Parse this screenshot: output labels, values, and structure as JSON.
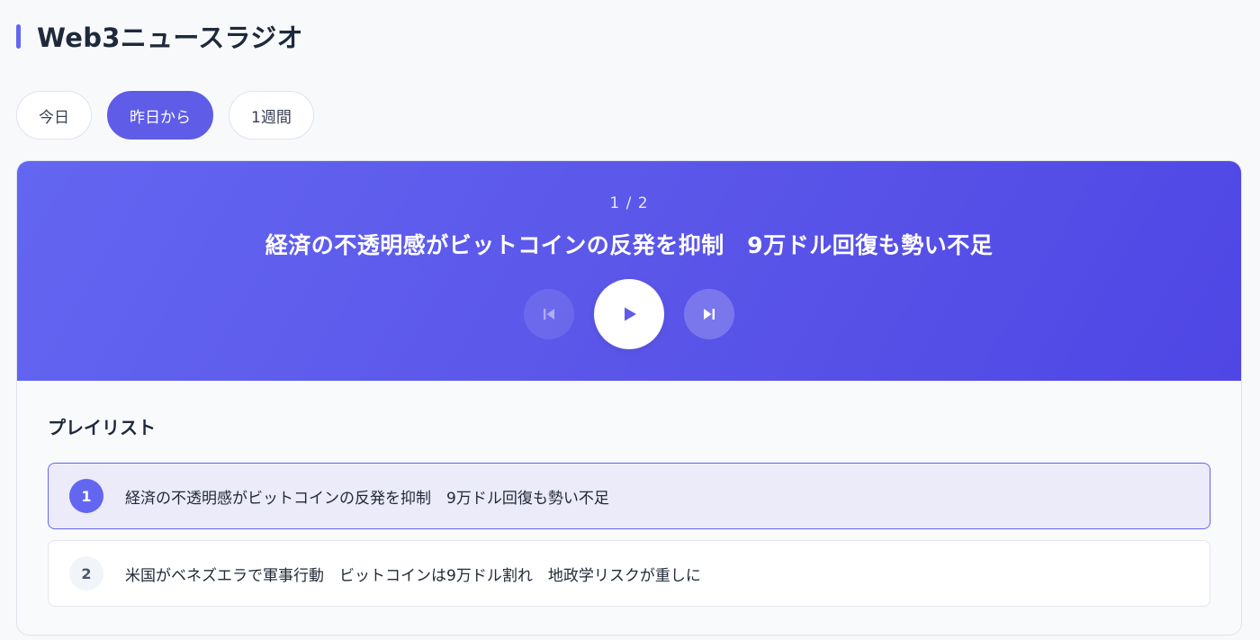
{
  "app": {
    "title": "Web3ニュースラジオ"
  },
  "tabs": [
    {
      "label": "今日",
      "active": false
    },
    {
      "label": "昨日から",
      "active": true
    },
    {
      "label": "1週間",
      "active": false
    }
  ],
  "player": {
    "counter": "1 / 2",
    "now_playing": "経済の不透明感がビットコインの反発を抑制　9万ドル回復も勢い不足",
    "controls": {
      "prev_icon": "skip-previous-icon",
      "play_icon": "play-icon",
      "next_icon": "skip-next-icon"
    }
  },
  "playlist": {
    "heading": "プレイリスト",
    "items": [
      {
        "number": "1",
        "title": "経済の不透明感がビットコインの反発を抑制　9万ドル回復も勢い不足",
        "active": true
      },
      {
        "number": "2",
        "title": "米国がベネズエラで軍事行動　ビットコインは9万ドル割れ　地政学リスクが重しに",
        "active": false
      }
    ]
  },
  "colors": {
    "accent": "#6366f1",
    "active_tab": "#5f5ce8",
    "active_item_bg": "#ebebfa"
  }
}
